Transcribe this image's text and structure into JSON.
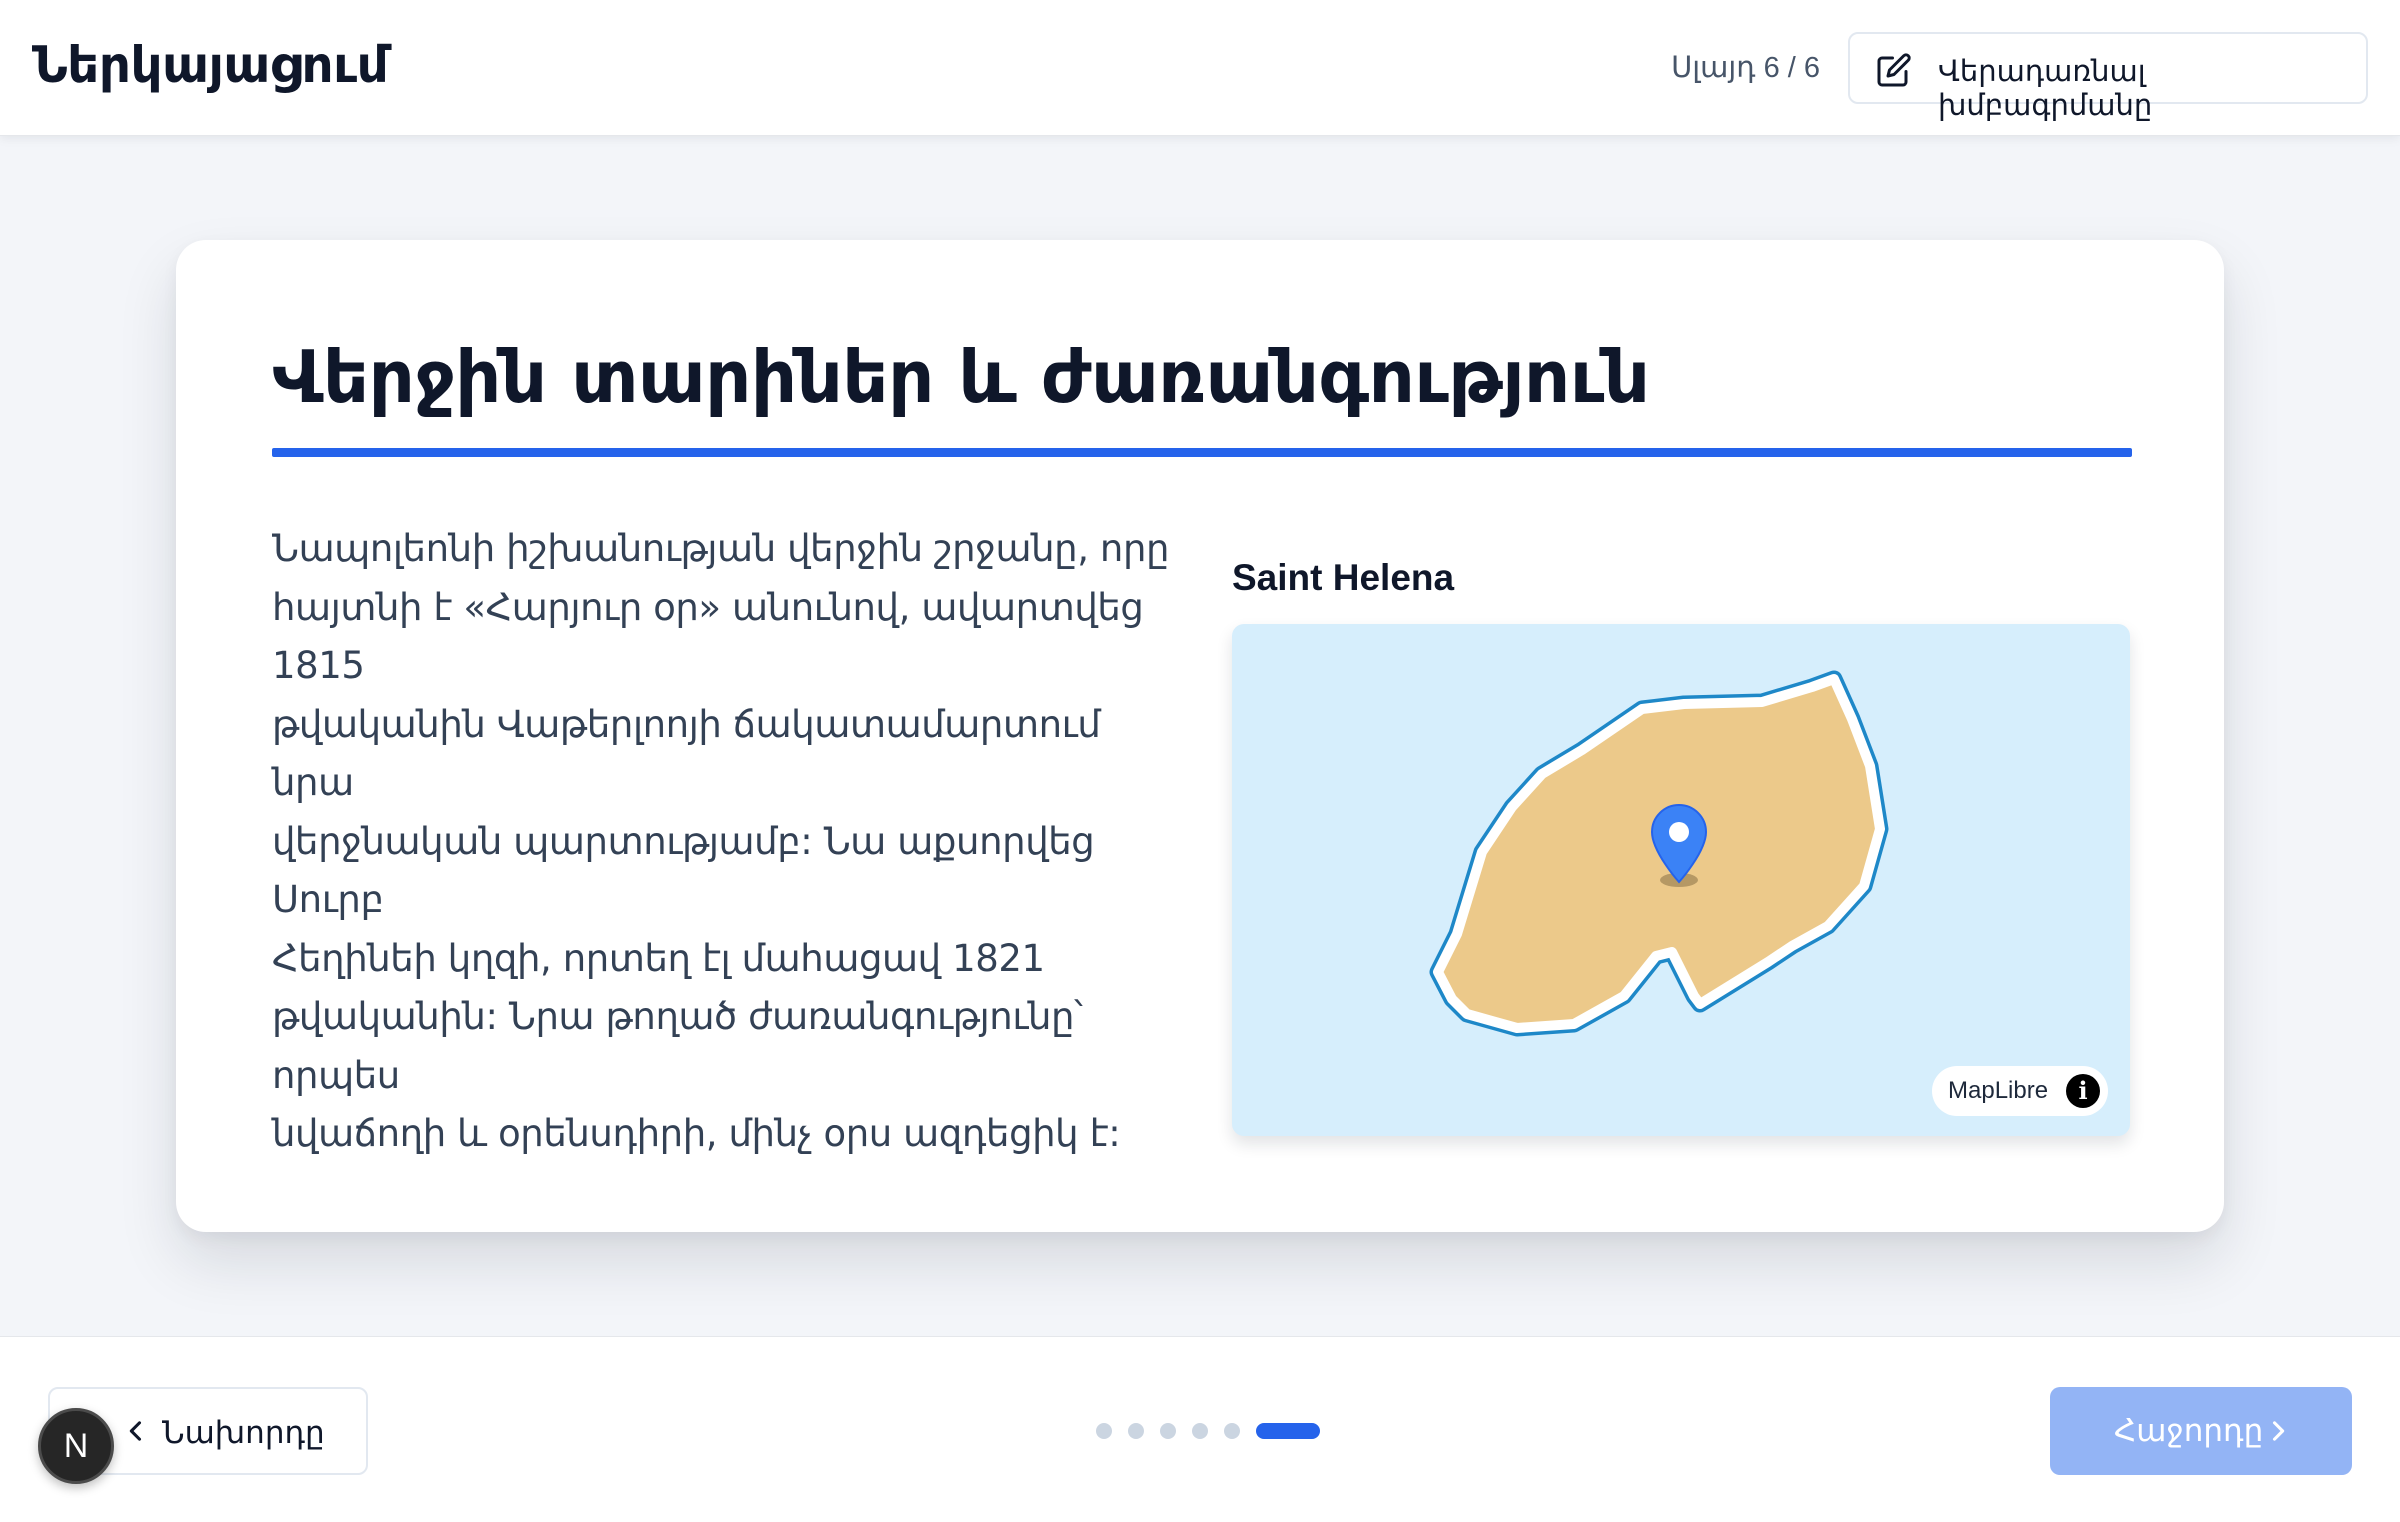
{
  "header": {
    "app_title": "Ներկայացում",
    "slide_counter": "Սլայդ 6 / 6",
    "edit_button_label": "Վերադառնալ խմբագրմանը",
    "edit_icon": "pencil-square-icon"
  },
  "slide": {
    "title": "Վերջին տարիներ և ժառանգություն",
    "body_lines": [
      "Նապոլեոնի իշխանության վերջին շրջանը, որը",
      "հայտնի է «Հարյուր օր» անունով, ավարտվեց 1815",
      "թվականին Վաթերլոոյի ճակատամարտում նրա",
      "վերջնական պարտությամբ: Նա աքսորվեց Սուրբ",
      "Հեղինեի կղզի, որտեղ էլ մահացավ 1821",
      "թվականին: Նրա թողած ժառանգությունը՝ որպես",
      "նվաճողի և օրենսդիրի, մինչ օրս ազդեցիկ է:"
    ],
    "map": {
      "title": "Saint Helena",
      "attribution": "MapLibre",
      "marker_icon": "map-pin-icon",
      "info_icon": "info-icon",
      "colors": {
        "water": "#d6eefc",
        "land": "#ecc98a",
        "outline": "#1e88c8",
        "marker": "#3b82f6"
      }
    }
  },
  "footer": {
    "prev_label": "Նախորդը",
    "next_label": "Հաջորդը",
    "dot_count": 6,
    "active_dot": 6
  },
  "badge": {
    "label": "N"
  },
  "colors": {
    "accent": "#2563eb",
    "next_button_disabled": "#93b4f5"
  }
}
